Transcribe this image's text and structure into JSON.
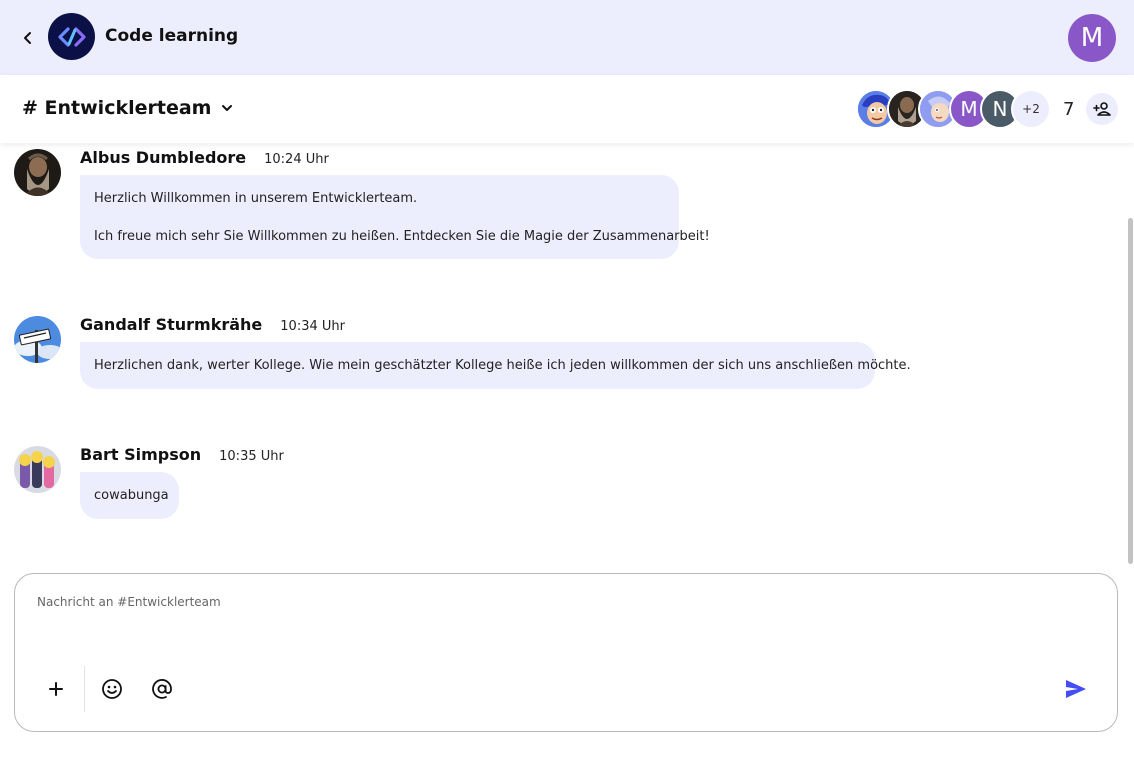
{
  "app": {
    "title": "Code learning",
    "user_initial": "M",
    "colors": {
      "header_bg": "#eceefe",
      "logo_bg": "#0b1046",
      "user_avatar": "#8a57c8",
      "accent": "#444df2"
    }
  },
  "channel": {
    "name": "# Entwicklerteam",
    "members": [
      {
        "type": "image",
        "icon": "cartoon-face-blue"
      },
      {
        "type": "image",
        "icon": "wizard-portrait"
      },
      {
        "type": "image",
        "icon": "cartoon-face-girl"
      },
      {
        "type": "initial",
        "initial": "M",
        "color": "#8a57c8"
      },
      {
        "type": "initial",
        "initial": "N",
        "color": "#4a5a66"
      }
    ],
    "more_members": "+2",
    "member_count": "7"
  },
  "messages": [
    {
      "author": "Albus Dumbledore",
      "time": "10:24 Uhr",
      "avatar_icon": "wizard-portrait",
      "lines": [
        "Herzlich Willkommen in unserem Entwicklerteam.",
        "",
        "Ich freue mich sehr Sie Willkommen zu heißen. Entdecken Sie die Magie der Zusammenarbeit!"
      ]
    },
    {
      "author": "Gandalf Sturmkrähe",
      "time": "10:34 Uhr",
      "avatar_icon": "road-sign-sky",
      "lines": [
        "Herzlichen dank, werter Kollege. Wie mein geschätzter Kollege heiße ich jeden willkommen der sich uns anschließen möchte."
      ]
    },
    {
      "author": "Bart Simpson",
      "time": "10:35 Uhr",
      "avatar_icon": "cartoon-group",
      "lines": [
        "cowabunga"
      ]
    }
  ],
  "composer": {
    "placeholder": "Nachricht an #Entwicklerteam",
    "value": ""
  }
}
